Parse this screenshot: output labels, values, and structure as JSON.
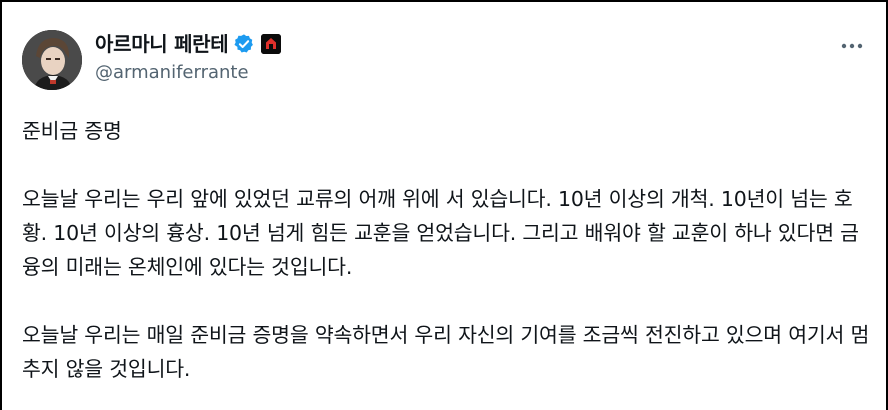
{
  "user": {
    "display_name": "아르마니 페란테",
    "handle": "@armaniferrante"
  },
  "icons": {
    "verified": "verified-badge-icon",
    "affiliate": "affiliate-badge-icon",
    "more": "more-options-icon"
  },
  "colors": {
    "verified_blue": "#1d9bf0",
    "text_primary": "#0f1419",
    "text_secondary": "#536471",
    "badge_red": "#e0302b"
  },
  "tweet": {
    "paragraphs": [
      "준비금 증명",
      "오늘날 우리는 우리 앞에 있었던 교류의 어깨 위에 서 있습니다. 10년 이상의 개척. 10년이 넘는 호황. 10년 이상의 흉상. 10년 넘게 힘든 교훈을 얻었습니다. 그리고 배워야 할 교훈이 하나 있다면 금융의 미래는 온체인에 있다는 것입니다.",
      "오늘날 우리는 매일 준비금 증명을 약속하면서 우리 자신의 기여를 조금씩 전진하고 있으며 여기서 멈추지 않을 것입니다."
    ]
  }
}
